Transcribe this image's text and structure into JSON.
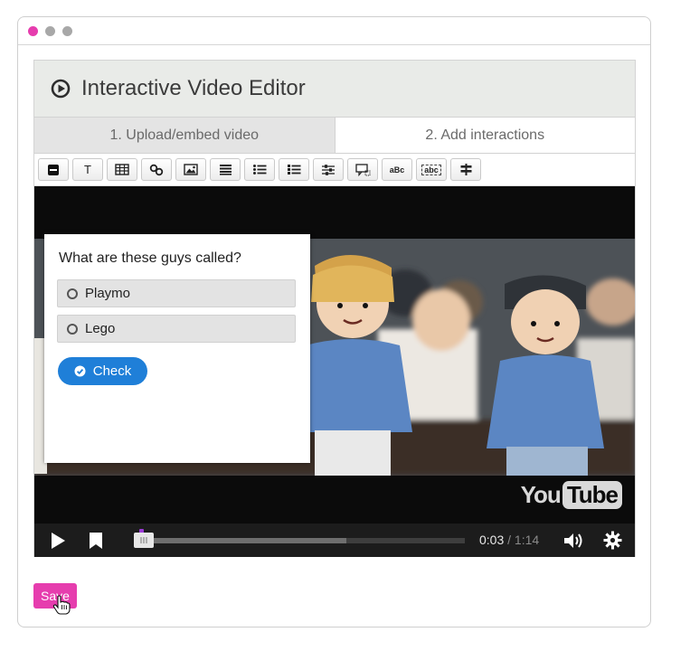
{
  "window": {
    "dots": [
      "#e63dae",
      "#a8a8a8",
      "#a8a8a8"
    ]
  },
  "editor": {
    "title": "Interactive Video Editor",
    "tabs": [
      {
        "label": "1. Upload/embed video"
      },
      {
        "label": "2. Add interactions"
      }
    ],
    "toolbar": [
      {
        "name": "statements-tool",
        "icon": "minus-square-icon"
      },
      {
        "name": "text-tool",
        "icon": "text-t-icon",
        "label": "T"
      },
      {
        "name": "table-tool",
        "icon": "table-icon"
      },
      {
        "name": "link-tool",
        "icon": "link-icon"
      },
      {
        "name": "image-tool",
        "icon": "image-icon"
      },
      {
        "name": "summary-tool",
        "icon": "list-icon"
      },
      {
        "name": "single-choice-tool",
        "icon": "bulleted-list-icon"
      },
      {
        "name": "multiple-choice-tool",
        "icon": "checklist-icon"
      },
      {
        "name": "true-false-tool",
        "icon": "sliders-icon"
      },
      {
        "name": "dialog-tool",
        "icon": "speech-bubble-icon"
      },
      {
        "name": "fill-blanks-tool",
        "icon": "abc-icon",
        "label": "aBc"
      },
      {
        "name": "drag-text-tool",
        "icon": "abc-box-icon",
        "label": "abc"
      },
      {
        "name": "navigation-tool",
        "icon": "signpost-icon"
      }
    ]
  },
  "quiz": {
    "question": "What are these guys called?",
    "answers": [
      {
        "label": "Playmo"
      },
      {
        "label": "Lego"
      }
    ],
    "check_label": "Check"
  },
  "player": {
    "logo_you": "You",
    "logo_tube": "Tube",
    "current_time": "0:03",
    "separator": "/",
    "duration": "1:14",
    "progress_played": 0.04,
    "progress_buffered": 0.64
  },
  "footer": {
    "save_label": "Save"
  },
  "colors": {
    "accent": "#e63dae",
    "check_button": "#1f7fd8",
    "marker": "#9b3bd6"
  }
}
